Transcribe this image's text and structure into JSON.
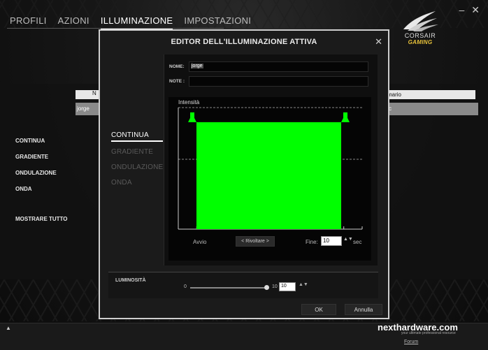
{
  "top_nav": {
    "tabs": [
      {
        "label": "PROFILI",
        "active": false
      },
      {
        "label": "AZIONI",
        "active": false
      },
      {
        "label": "ILLUMINAZIONE",
        "active": true
      },
      {
        "label": "IMPOSTAZIONI",
        "active": false
      }
    ]
  },
  "window_controls": {
    "minimize": "–",
    "close": "✕"
  },
  "logo": {
    "brand": "CORSAIR",
    "sub": "GAMING"
  },
  "bg_table": {
    "head_left": "N",
    "head_right": "mario",
    "row_left": "jorge",
    "row_right": "c"
  },
  "left_menu": {
    "items": [
      "CONTINUA",
      "GRADIENTE",
      "ONDULAZIONE",
      "ONDA"
    ],
    "show_all": "MOSTRARE TUTTO"
  },
  "modal": {
    "title": "EDITOR DELL'ILLUMINAZIONE ATTIVA",
    "close_glyph": "✕",
    "modes": [
      {
        "label": "CONTINUA",
        "active": true
      },
      {
        "label": "GRADIENTE",
        "active": false
      },
      {
        "label": "ONDULAZIONE",
        "active": false
      },
      {
        "label": "ONDA",
        "active": false
      }
    ],
    "name_label": "NOME:",
    "name_value": "jorge",
    "notes_label": "NOTE :",
    "notes_value": "",
    "chart": {
      "intensity_label": "Intensità",
      "start_label": "Avvio",
      "prev_button": "< Rivoltare >",
      "end_label": "Fine:",
      "end_value": "10",
      "unit": "sec",
      "color": "#00ff00",
      "level": 0.88
    },
    "brightness": {
      "label": "LUMINOSITÀ",
      "min": "0",
      "max": "10",
      "value": "10",
      "fraction": 1.0
    },
    "ok_label": "OK",
    "cancel_label": "Annulla"
  },
  "taskbar": {
    "up_glyph": "▲"
  },
  "watermark": {
    "site": "nexthardware.com",
    "tagline": "your ultimate professional resource",
    "forum": "Forum"
  }
}
